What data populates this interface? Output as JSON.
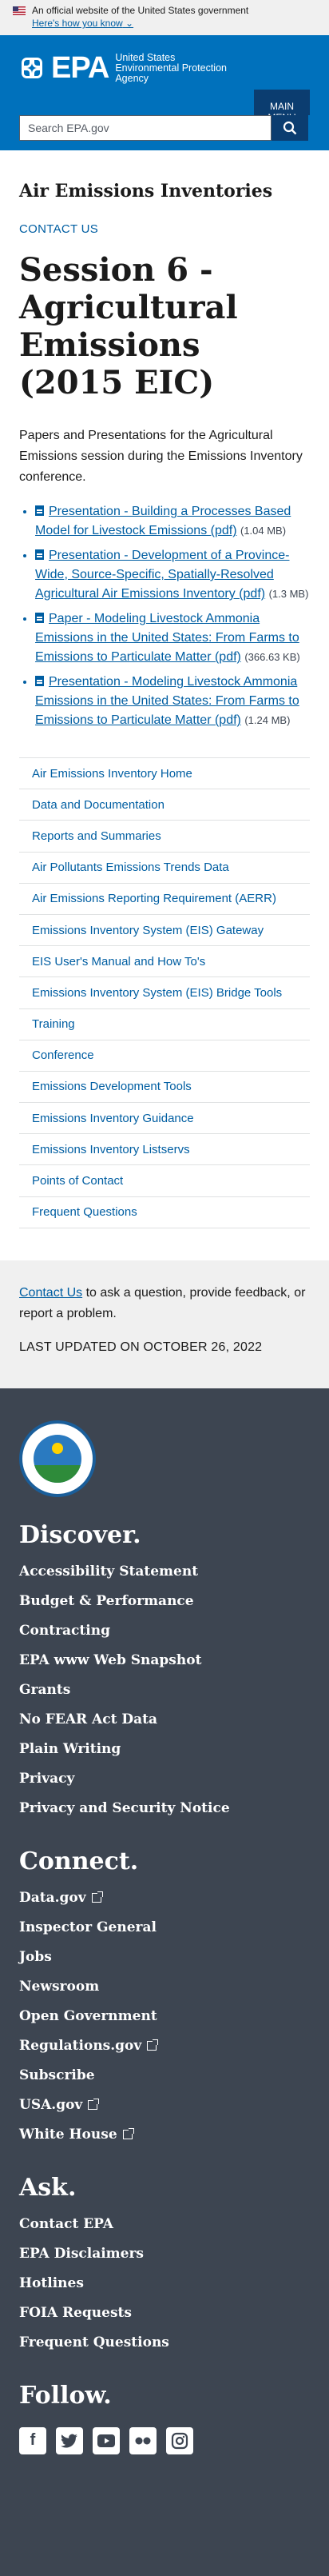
{
  "gov_banner": {
    "official_text": "An official website of the United States government",
    "how_know": "Here's how you know"
  },
  "header": {
    "logo_text": "EPA",
    "agency_name": "United States Environmental Protection Agency",
    "menu_label_1": "MAIN",
    "menu_label_2": "MENU",
    "search_placeholder": "Search EPA.gov"
  },
  "main": {
    "site_title": "Air Emissions Inventories",
    "contact_link": "CONTACT US",
    "page_title": "Session 6 - Agricultural Emissions (2015 EIC)",
    "intro": "Papers and Presentations for the Agricultural Emissions session during the Emissions Inventory conference.",
    "documents": [
      {
        "title": "Presentation - Building a Processes Based Model for Livestock Emissions (pdf)",
        "size": "(1.04 MB)"
      },
      {
        "title": "Presentation - Development of a Province-Wide, Source-Specific, Spatially-Resolved Agricultural Air Emissions Inventory (pdf)",
        "size": "(1.3 MB)"
      },
      {
        "title": "Paper - Modeling Livestock Ammonia Emissions in the United States: From Farms to Emissions to Particulate Matter (pdf)",
        "size": "(366.63 KB)"
      },
      {
        "title": "Presentation - Modeling Livestock Ammonia Emissions in the United States: From Farms to Emissions to Particulate Matter (pdf)",
        "size": "(1.24 MB)"
      }
    ]
  },
  "sidenav": [
    "Air Emissions Inventory Home",
    "Data and Documentation",
    "Reports and Summaries",
    "Air Pollutants Emissions Trends Data",
    "Air Emissions Reporting Requirement (AERR)",
    "Emissions Inventory System (EIS) Gateway",
    "EIS User's Manual and How To's",
    "Emissions Inventory System (EIS) Bridge Tools",
    "Training",
    "Conference",
    "Emissions Development Tools",
    "Emissions Inventory Guidance",
    "Emissions Inventory Listservs",
    "Points of Contact",
    "Frequent Questions"
  ],
  "contact_footer": {
    "link": "Contact Us",
    "text": " to ask a question, provide feedback, or report a problem.",
    "updated": "LAST UPDATED ON OCTOBER 26, 2022"
  },
  "footer": {
    "discover_heading": "Discover.",
    "discover": [
      "Accessibility Statement",
      "Budget & Performance",
      "Contracting",
      "EPA www Web Snapshot",
      "Grants",
      "No FEAR Act Data",
      "Plain Writing",
      "Privacy",
      "Privacy and Security Notice"
    ],
    "connect_heading": "Connect.",
    "connect": [
      {
        "label": "Data.gov",
        "external": true
      },
      {
        "label": "Inspector General",
        "external": false
      },
      {
        "label": "Jobs",
        "external": false
      },
      {
        "label": "Newsroom",
        "external": false
      },
      {
        "label": "Open Government",
        "external": false
      },
      {
        "label": "Regulations.gov",
        "external": true
      },
      {
        "label": "Subscribe",
        "external": false
      },
      {
        "label": "USA.gov",
        "external": true
      },
      {
        "label": "White House",
        "external": true
      }
    ],
    "ask_heading": "Ask.",
    "ask": [
      "Contact EPA",
      "EPA Disclaimers",
      "Hotlines",
      "FOIA Requests",
      "Frequent Questions"
    ],
    "follow_heading": "Follow.",
    "social_icons": [
      "facebook-icon",
      "twitter-icon",
      "youtube-icon",
      "flickr-icon",
      "instagram-icon"
    ]
  }
}
